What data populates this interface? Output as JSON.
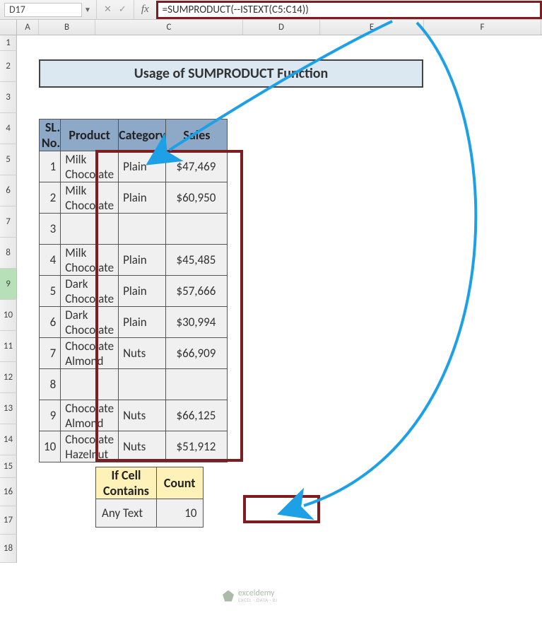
{
  "name_box": "D17",
  "formula": "=SUMPRODUCT(--ISTEXT(C5:C14))",
  "columns": [
    "A",
    "B",
    "C",
    "D",
    "E",
    "F"
  ],
  "row_numbers": [
    "1",
    "2",
    "3",
    "4",
    "5",
    "6",
    "7",
    "8",
    "9",
    "10",
    "11",
    "12",
    "13",
    "14",
    "15",
    "16",
    "17",
    "18"
  ],
  "selected_row": "9",
  "title": "Usage of SUMPRODUCT Function",
  "headers": {
    "sl": "SL. No.",
    "product": "Product",
    "category": "Category",
    "sales": "Sales"
  },
  "rows": [
    {
      "sl": "1",
      "product": "Milk Chocolate",
      "category": "Plain",
      "sales": "47,469"
    },
    {
      "sl": "2",
      "product": "Milk Chocolate",
      "category": "Plain",
      "sales": "60,950"
    },
    {
      "sl": "3",
      "product": "",
      "category": "",
      "sales": ""
    },
    {
      "sl": "4",
      "product": "Milk Chocolate",
      "category": "Plain",
      "sales": "45,485"
    },
    {
      "sl": "5",
      "product": "Dark Chocolate",
      "category": "Plain",
      "sales": "57,666"
    },
    {
      "sl": "6",
      "product": "Dark Chocolate",
      "category": "Plain",
      "sales": "30,994"
    },
    {
      "sl": "7",
      "product": "Chocolate Almond",
      "category": "Nuts",
      "sales": "66,909"
    },
    {
      "sl": "8",
      "product": "",
      "category": "",
      "sales": ""
    },
    {
      "sl": "9",
      "product": "Chocolate Almond",
      "category": "Nuts",
      "sales": "66,125"
    },
    {
      "sl": "10",
      "product": "Chocolate Hazelnut",
      "category": "Nuts",
      "sales": "51,912"
    }
  ],
  "currency": "$",
  "count_table": {
    "h1": "If Cell Contains",
    "h2": "Count",
    "label": "Any Text",
    "value": "10"
  },
  "watermark": {
    "name": "exceldemy",
    "sub": "EXCEL · DATA · BI"
  },
  "chart_data": {
    "type": "table",
    "title": "Usage of SUMPRODUCT Function",
    "columns": [
      "SL. No.",
      "Product",
      "Category",
      "Sales"
    ],
    "rows": [
      [
        1,
        "Milk Chocolate",
        "Plain",
        47469
      ],
      [
        2,
        "Milk Chocolate",
        "Plain",
        60950
      ],
      [
        3,
        "",
        "",
        null
      ],
      [
        4,
        "Milk Chocolate",
        "Plain",
        45485
      ],
      [
        5,
        "Dark Chocolate",
        "Plain",
        57666
      ],
      [
        6,
        "Dark Chocolate",
        "Plain",
        30994
      ],
      [
        7,
        "Chocolate Almond",
        "Nuts",
        66909
      ],
      [
        8,
        "",
        "",
        null
      ],
      [
        9,
        "Chocolate Almond",
        "Nuts",
        66125
      ],
      [
        10,
        "Chocolate Hazelnut",
        "Nuts",
        51912
      ]
    ],
    "count_any_text": 10,
    "formula": "=SUMPRODUCT(--ISTEXT(C5:C14))"
  }
}
